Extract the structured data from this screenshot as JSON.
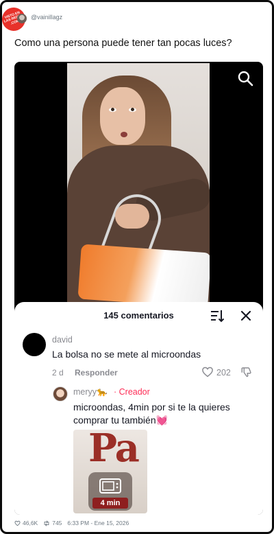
{
  "header": {
    "site_logo_text": "VISTO EN LAS REDES .COM",
    "handle": "@vainillagz",
    "tweet_text": "Como una persona puede tener tan pocas luces?"
  },
  "video": {
    "search_icon": "search-icon"
  },
  "comments_sheet": {
    "title": "145 comentarios",
    "sort_icon": "sort-icon",
    "close_icon": "close-icon"
  },
  "comment": {
    "user": "david",
    "text": "La bolsa no se mete al microondas",
    "time": "2 d",
    "reply_label": "Responder",
    "likes": "202"
  },
  "reply": {
    "user": "meryy🐆",
    "badge": "· Creador",
    "text": "microondas, 4min por si te la quieres comprar tu también💓",
    "image_letters": "Pa",
    "image_label": "4 min"
  },
  "footer": {
    "likes": "46,6K",
    "retweets": "745",
    "timestamp": "6:33 PM - Ene 15, 2026"
  },
  "colors": {
    "accent": "#fe2c55",
    "secondary_text": "#8a8b91"
  }
}
